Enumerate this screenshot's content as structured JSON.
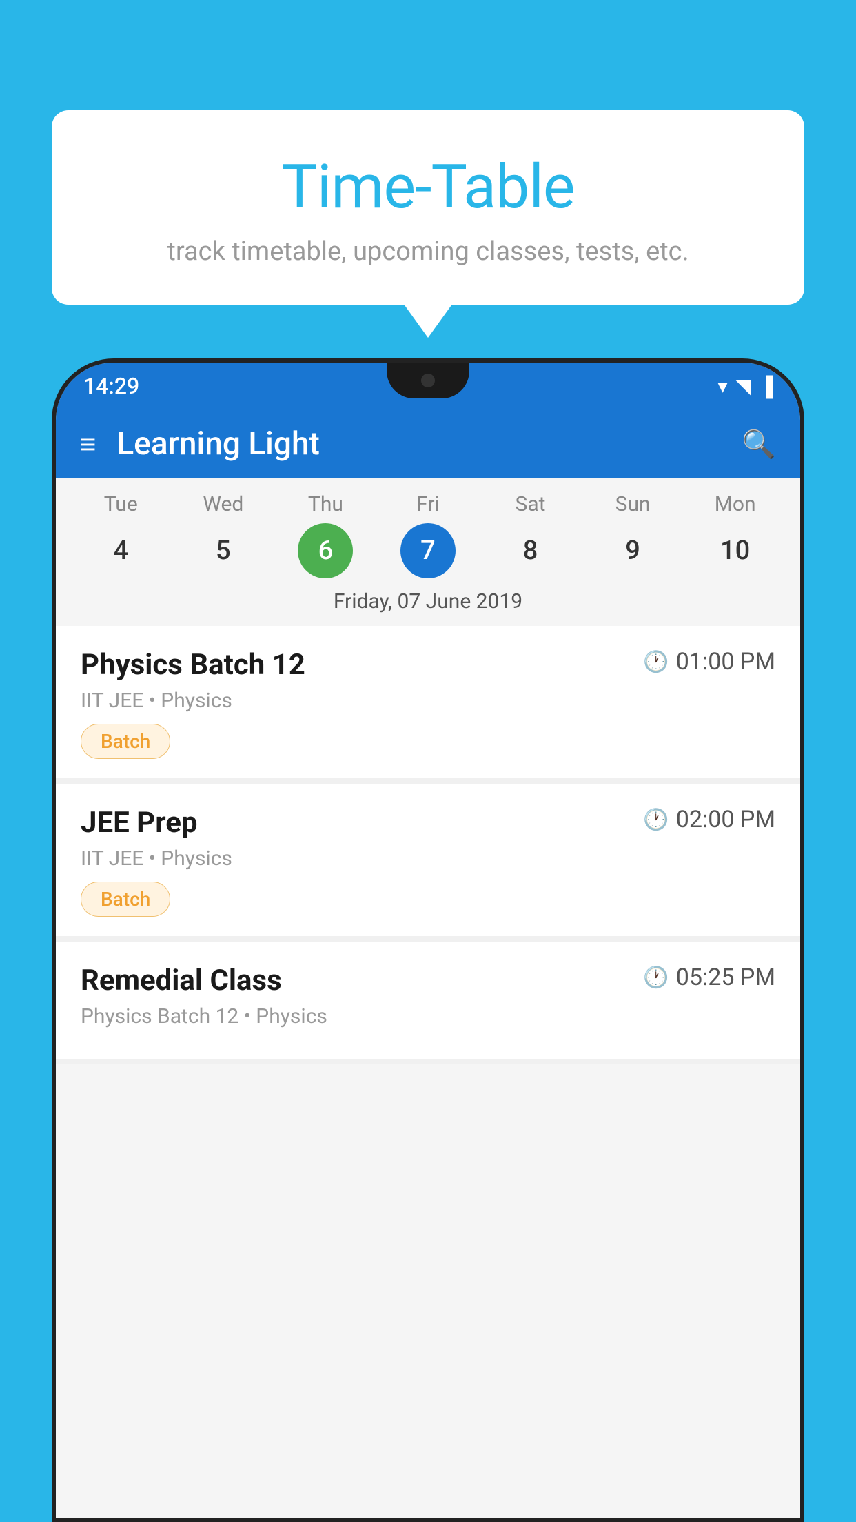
{
  "bubble": {
    "title": "Time-Table",
    "subtitle": "track timetable, upcoming classes, tests, etc."
  },
  "phone": {
    "status_time": "14:29",
    "app_title": "Learning Light",
    "selected_date_label": "Friday, 07 June 2019",
    "calendar": {
      "days": [
        {
          "label": "Tue",
          "number": "4",
          "state": "normal"
        },
        {
          "label": "Wed",
          "number": "5",
          "state": "normal"
        },
        {
          "label": "Thu",
          "number": "6",
          "state": "today"
        },
        {
          "label": "Fri",
          "number": "7",
          "state": "selected"
        },
        {
          "label": "Sat",
          "number": "8",
          "state": "normal"
        },
        {
          "label": "Sun",
          "number": "9",
          "state": "normal"
        },
        {
          "label": "Mon",
          "number": "10",
          "state": "normal"
        }
      ]
    },
    "schedule": [
      {
        "title": "Physics Batch 12",
        "time": "01:00 PM",
        "subtitle": "IIT JEE • Physics",
        "badge": "Batch"
      },
      {
        "title": "JEE Prep",
        "time": "02:00 PM",
        "subtitle": "IIT JEE • Physics",
        "badge": "Batch"
      },
      {
        "title": "Remedial Class",
        "time": "05:25 PM",
        "subtitle": "Physics Batch 12 • Physics",
        "badge": ""
      }
    ]
  },
  "icons": {
    "hamburger": "≡",
    "search": "🔍",
    "clock": "🕐"
  }
}
